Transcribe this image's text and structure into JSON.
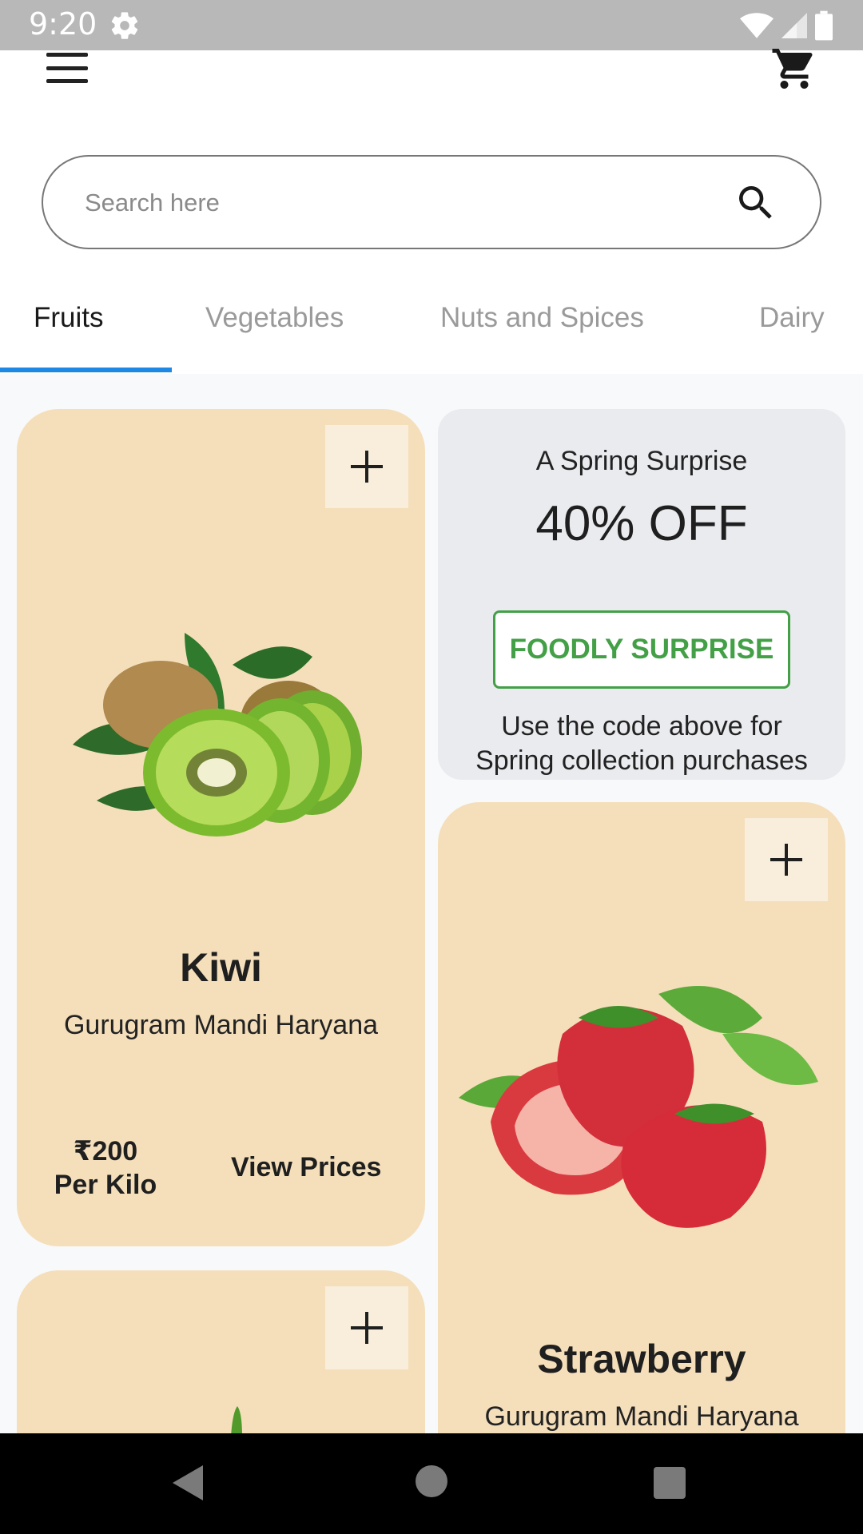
{
  "status_bar": {
    "time": "9:20"
  },
  "search": {
    "placeholder": "Search here",
    "value": ""
  },
  "tabs": [
    {
      "label": "Fruits",
      "active": true
    },
    {
      "label": "Vegetables",
      "active": false
    },
    {
      "label": "Nuts and Spices",
      "active": false
    },
    {
      "label": "Dairy",
      "active": false
    }
  ],
  "colors": {
    "accent": "#1e88e5",
    "card_bg": "#f5dfbb",
    "promo_bg": "#eaebef",
    "promo_code": "#43a047"
  },
  "promo": {
    "subtitle": "A Spring Surprise",
    "discount": "40% OFF",
    "code": "FOODLY SURPRISE",
    "description_line1": "Use the code above for",
    "description_line2": "Spring collection purchases"
  },
  "products": [
    {
      "name": "Kiwi",
      "origin": "Gurugram Mandi Haryana",
      "price": "₹200",
      "unit": "Per Kilo",
      "action": "View Prices"
    },
    {
      "name": "Strawberry",
      "origin": "Gurugram Mandi Haryana"
    },
    {
      "name": "",
      "origin": ""
    }
  ],
  "icons": {
    "menu": "menu-icon",
    "cart": "cart-icon",
    "search": "search-icon",
    "add": "plus-icon"
  }
}
